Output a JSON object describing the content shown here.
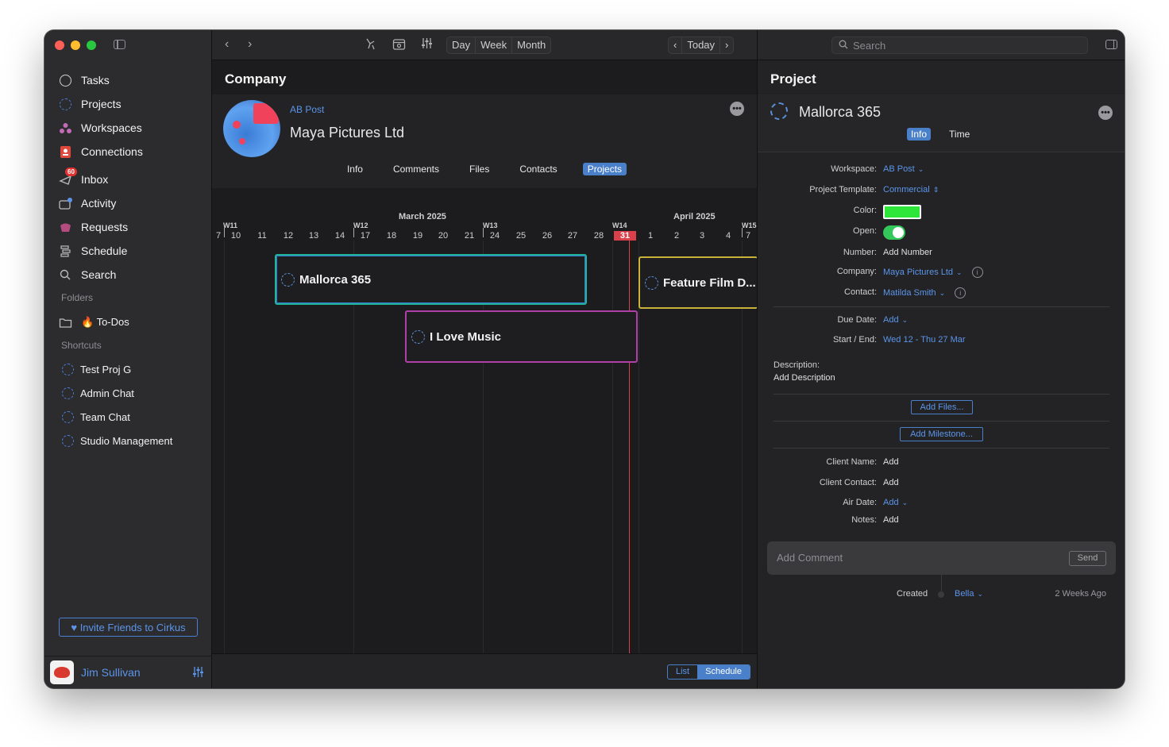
{
  "sidebar": {
    "nav": [
      {
        "label": "Tasks",
        "icon": "circle-icon"
      },
      {
        "label": "Projects",
        "icon": "dashed-circle-icon"
      },
      {
        "label": "Workspaces",
        "icon": "workspaces-icon"
      },
      {
        "label": "Connections",
        "icon": "connections-icon"
      },
      {
        "label": "Inbox",
        "icon": "inbox-icon",
        "badge": "60"
      },
      {
        "label": "Activity",
        "icon": "activity-icon"
      },
      {
        "label": "Requests",
        "icon": "requests-icon"
      },
      {
        "label": "Schedule",
        "icon": "schedule-icon"
      },
      {
        "label": "Search",
        "icon": "search-icon"
      }
    ],
    "folders_heading": "Folders",
    "folders": [
      {
        "label": "🔥 To-Dos",
        "icon": "folder-icon"
      }
    ],
    "shortcuts_heading": "Shortcuts",
    "shortcuts": [
      {
        "label": "Test Proj G"
      },
      {
        "label": "Admin Chat"
      },
      {
        "label": "Team Chat"
      },
      {
        "label": "Studio Management"
      }
    ],
    "invite_label": "♥ Invite Friends to Cirkus",
    "user": {
      "name": "Jim Sullivan"
    }
  },
  "toolbar": {
    "view_modes": [
      "Day",
      "Week",
      "Month"
    ],
    "today_label": "Today"
  },
  "company": {
    "section_title": "Company",
    "workspace": "AB Post",
    "name": "Maya Pictures Ltd",
    "tabs": [
      "Info",
      "Comments",
      "Files",
      "Contacts",
      "Projects"
    ],
    "active_tab": "Projects"
  },
  "timeline": {
    "months": [
      "March 2025",
      "April 2025"
    ],
    "weeks": [
      "W11",
      "W12",
      "W13",
      "W14",
      "W15"
    ],
    "days": [
      "7",
      "10",
      "11",
      "12",
      "13",
      "14",
      "17",
      "18",
      "19",
      "20",
      "21",
      "24",
      "25",
      "26",
      "27",
      "28",
      "31",
      "1",
      "2",
      "3",
      "4",
      "7"
    ],
    "today": "31",
    "projects": [
      {
        "name": "Mallorca 365",
        "color": "#1fb39a"
      },
      {
        "name": "I Love Music",
        "color": "#b23fa8"
      },
      {
        "name": "Feature Film D...",
        "color": "#c9b23a"
      }
    ]
  },
  "view_switch": {
    "options": [
      "List",
      "Schedule"
    ],
    "active": "Schedule"
  },
  "detail": {
    "search_placeholder": "Search",
    "section_title": "Project",
    "project_name": "Mallorca 365",
    "tabs": [
      "Info",
      "Time"
    ],
    "active_tab": "Info",
    "fields": {
      "workspace": {
        "label": "Workspace:",
        "value": "AB Post"
      },
      "template": {
        "label": "Project Template:",
        "value": "Commercial"
      },
      "color": {
        "label": "Color:",
        "value": "#2ee63a"
      },
      "open": {
        "label": "Open:",
        "value": true
      },
      "number": {
        "label": "Number:",
        "value": "Add Number"
      },
      "company": {
        "label": "Company:",
        "value": "Maya Pictures Ltd"
      },
      "contact": {
        "label": "Contact:",
        "value": "Matilda Smith"
      },
      "due": {
        "label": "Due Date:",
        "value": "Add"
      },
      "start_end": {
        "label": "Start / End:",
        "value": "Wed 12 - Thu 27 Mar"
      },
      "description_label": "Description:",
      "description_value": "Add Description",
      "client_name": {
        "label": "Client Name:",
        "value": "Add"
      },
      "client_contact": {
        "label": "Client Contact:",
        "value": "Add"
      },
      "air_date": {
        "label": "Air Date:",
        "value": "Add"
      },
      "notes": {
        "label": "Notes:",
        "value": "Add"
      }
    },
    "add_files_label": "Add Files...",
    "add_milestone_label": "Add Milestone...",
    "comment_placeholder": "Add Comment",
    "send_label": "Send",
    "created_label": "Created",
    "created_by": "Bella",
    "created_ago": "2 Weeks Ago"
  }
}
